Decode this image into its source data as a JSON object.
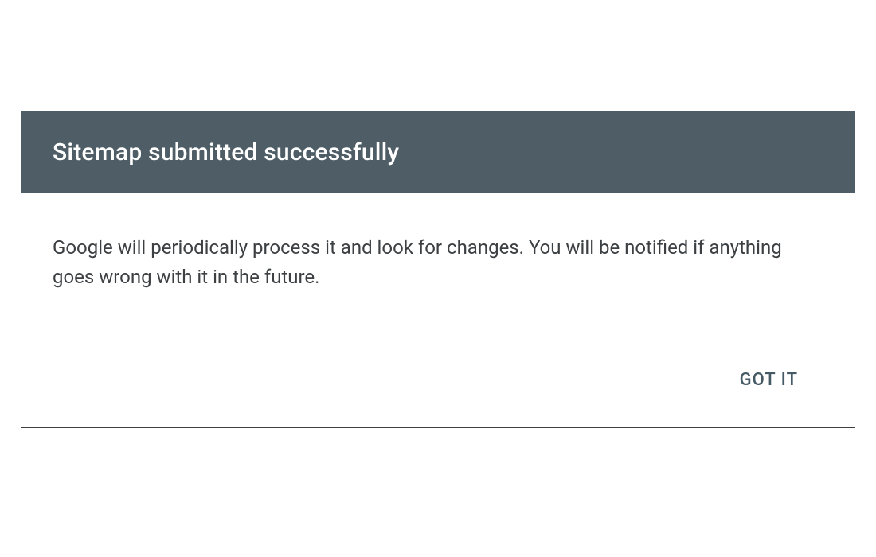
{
  "dialog": {
    "title": "Sitemap submitted successfully",
    "message": "Google will periodically process it and look for changes. You will be notified if anything goes wrong with it in the future.",
    "confirm_label": "GOT IT"
  },
  "colors": {
    "header_bg": "#4e5d66",
    "text": "#3c4043",
    "button_text": "#455a64"
  }
}
